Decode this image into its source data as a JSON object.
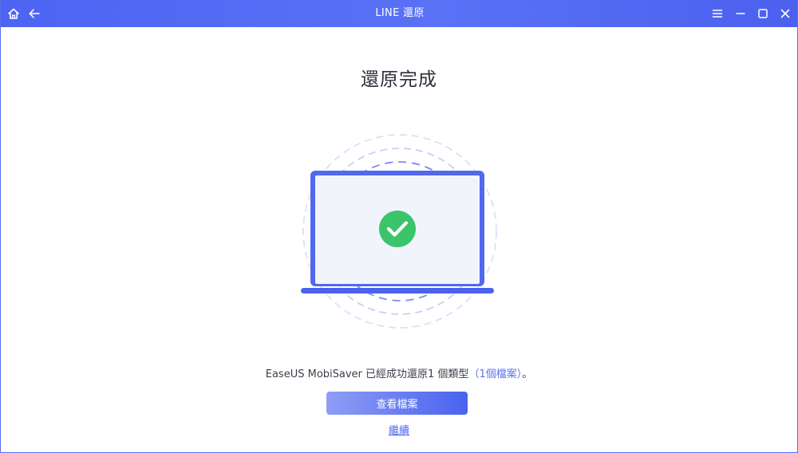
{
  "window": {
    "title": "LINE 還原",
    "icons": {
      "home": "home-icon",
      "back": "arrow-left-icon",
      "menu": "menu-icon",
      "minimize": "minimize-icon",
      "maximize": "maximize-icon",
      "close": "close-icon"
    }
  },
  "main": {
    "heading": "還原完成",
    "message": {
      "app_name": "EaseUS MobiSaver",
      "text": " 已經成功還原1 個類型",
      "link_text": "（1個檔案）",
      "suffix": "。"
    },
    "view_files_button": "查看檔案",
    "continue_link": "繼續"
  },
  "colors": {
    "titlebar": "#4d64f3",
    "accent": "#4a63ee",
    "success": "#3cc46a",
    "link": "#5a73e8"
  }
}
